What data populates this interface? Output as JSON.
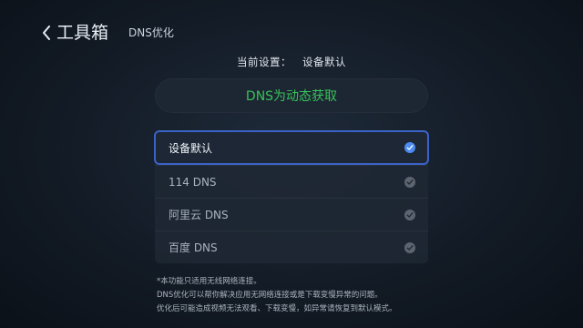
{
  "header": {
    "back_label": "工具箱",
    "subtitle": "DNS优化"
  },
  "current_setting": {
    "label": "当前设置：",
    "value": "设备默认"
  },
  "status": {
    "text": "DNS为动态获取",
    "color": "#37c25a"
  },
  "dns_options": [
    {
      "label": "设备默认",
      "selected": true
    },
    {
      "label": "114 DNS",
      "selected": false
    },
    {
      "label": "阿里云 DNS",
      "selected": false
    },
    {
      "label": "百度 DNS",
      "selected": false
    }
  ],
  "notes": [
    "*本功能只适用无线网络连接。",
    "DNS优化可以帮你解决应用无网络连接或是下载变慢异常的问题。",
    "优化后可能造成视频无法观看、下载变慢，如异常请恢复到默认模式。"
  ],
  "icons": {
    "back": "chevron-left-icon",
    "check": "checkmark-icon"
  },
  "colors": {
    "accent_blue": "#4c8bf2",
    "selection_border": "#3b63c7",
    "status_green": "#37c25a"
  }
}
